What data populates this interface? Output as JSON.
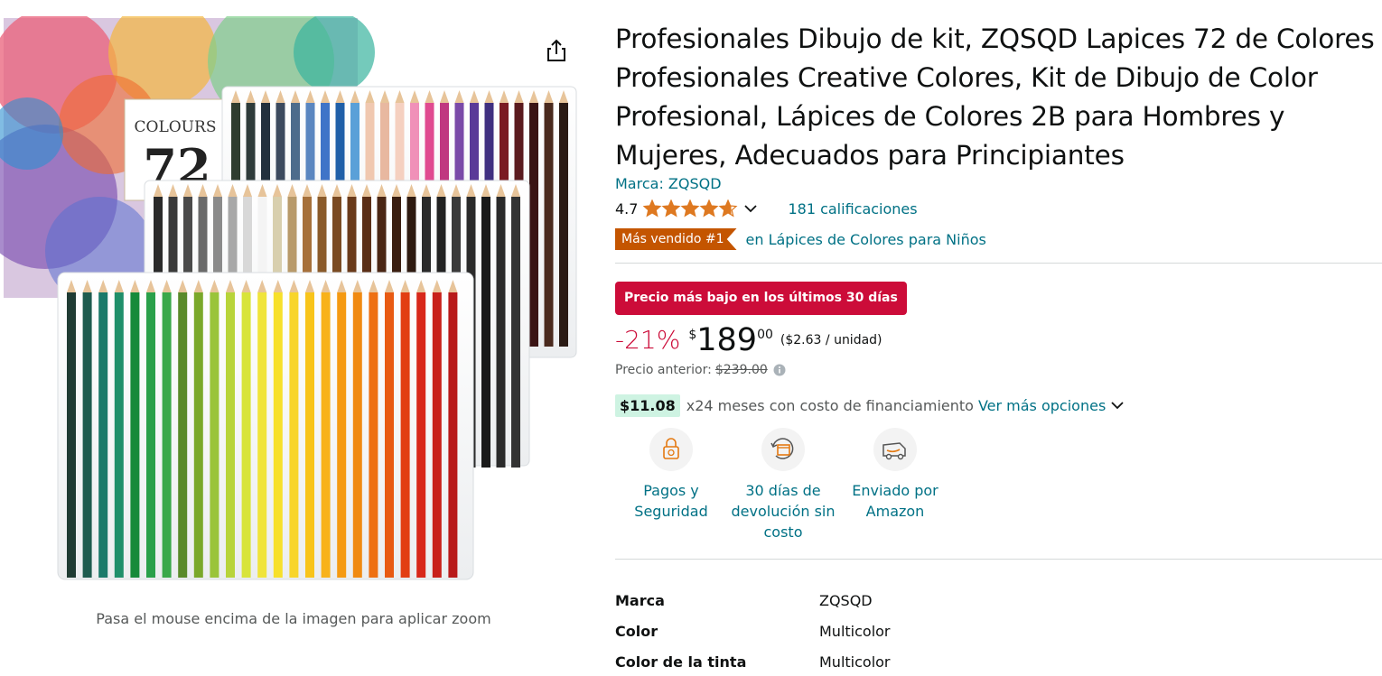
{
  "image": {
    "box_label": "COLOURS",
    "box_number": "72",
    "zoom_hint": "Pasa el mouse encima de la imagen para aplicar zoom",
    "share_icon": "share-icon"
  },
  "product": {
    "title": "Profesionales Dibujo de kit, ZQSQD Lapices 72 de Colores Profesionales Creative Colores, Kit de Dibujo de Color Profesional, Lápices de Colores 2B para Hombres y Mujeres, Adecuados para Principiantes",
    "brand_link": "Marca: ZQSQD",
    "rating": "4.7",
    "stars": 4.7,
    "ratings_count": "181 calificaciones",
    "best_seller_badge": "Más vendido #1",
    "best_seller_category": "en Lápices de Colores para Niños"
  },
  "pricing": {
    "deal_badge": "Precio más bajo en los últimos 30 días",
    "discount": "-21%",
    "currency": "$",
    "price_whole": "189",
    "price_fraction": "00",
    "unit_price": "($2.63 / unidad)",
    "previous_label": "Precio anterior:",
    "previous_price": "$239.00",
    "financing_amount": "$11.08",
    "financing_text": "x24 meses con costo de financiamiento",
    "financing_link": "Ver más opciones"
  },
  "features": [
    {
      "label": "Pagos y Seguridad",
      "icon": "secure-payment-icon"
    },
    {
      "label": "30 días de devolución sin costo",
      "icon": "return-box-icon"
    },
    {
      "label": "Enviado por Amazon",
      "icon": "delivery-truck-icon"
    }
  ],
  "specs": [
    {
      "key": "Marca",
      "value": "ZQSQD"
    },
    {
      "key": "Color",
      "value": "Multicolor"
    },
    {
      "key": "Color de la tinta",
      "value": "Multicolor"
    }
  ],
  "colors": {
    "link": "#007185",
    "deal_red": "#cc0c39",
    "best_seller_orange": "#c45500",
    "star": "#de7921",
    "financing_bg": "#cef3e2"
  }
}
